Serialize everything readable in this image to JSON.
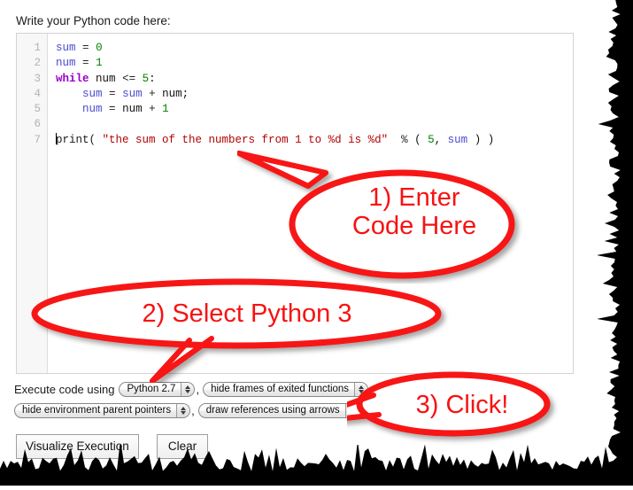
{
  "page": {
    "prompt_label": "Write your Python code here:"
  },
  "editor": {
    "line_numbers": [
      "1",
      "2",
      "3",
      "4",
      "5",
      "6",
      "7"
    ],
    "lines": [
      {
        "n": "1",
        "tokens": [
          {
            "t": "var",
            "s": "sum"
          },
          {
            "t": "plain",
            "s": " "
          },
          {
            "t": "op",
            "s": "="
          },
          {
            "t": "plain",
            "s": " "
          },
          {
            "t": "num",
            "s": "0"
          }
        ]
      },
      {
        "n": "2",
        "tokens": [
          {
            "t": "var",
            "s": "num"
          },
          {
            "t": "plain",
            "s": " "
          },
          {
            "t": "op",
            "s": "="
          },
          {
            "t": "plain",
            "s": " "
          },
          {
            "t": "num",
            "s": "1"
          }
        ]
      },
      {
        "n": "3",
        "tokens": [
          {
            "t": "kw",
            "s": "while"
          },
          {
            "t": "plain",
            "s": " "
          },
          {
            "t": "plain",
            "s": "num"
          },
          {
            "t": "plain",
            "s": " "
          },
          {
            "t": "op",
            "s": "<="
          },
          {
            "t": "plain",
            "s": " "
          },
          {
            "t": "num",
            "s": "5"
          },
          {
            "t": "plain",
            "s": ":"
          }
        ]
      },
      {
        "n": "4",
        "tokens": [
          {
            "t": "plain",
            "s": "    "
          },
          {
            "t": "var",
            "s": "sum"
          },
          {
            "t": "plain",
            "s": " "
          },
          {
            "t": "op",
            "s": "="
          },
          {
            "t": "plain",
            "s": " "
          },
          {
            "t": "var",
            "s": "sum"
          },
          {
            "t": "plain",
            "s": " "
          },
          {
            "t": "op",
            "s": "+"
          },
          {
            "t": "plain",
            "s": " "
          },
          {
            "t": "plain",
            "s": "num;"
          }
        ]
      },
      {
        "n": "5",
        "tokens": [
          {
            "t": "plain",
            "s": "    "
          },
          {
            "t": "var",
            "s": "num"
          },
          {
            "t": "plain",
            "s": " "
          },
          {
            "t": "op",
            "s": "="
          },
          {
            "t": "plain",
            "s": " "
          },
          {
            "t": "plain",
            "s": "num"
          },
          {
            "t": "plain",
            "s": " "
          },
          {
            "t": "op",
            "s": "+"
          },
          {
            "t": "plain",
            "s": " "
          },
          {
            "t": "num",
            "s": "1"
          }
        ]
      },
      {
        "n": "6",
        "tokens": []
      },
      {
        "n": "7",
        "tokens": [
          {
            "t": "caret",
            "s": ""
          },
          {
            "t": "fn",
            "s": "print("
          },
          {
            "t": "plain",
            "s": " "
          },
          {
            "t": "str",
            "s": "\"the sum of the numbers from 1 to %d is %d\""
          },
          {
            "t": "plain",
            "s": "  "
          },
          {
            "t": "op",
            "s": "%"
          },
          {
            "t": "plain",
            "s": " ( "
          },
          {
            "t": "num",
            "s": "5"
          },
          {
            "t": "plain",
            "s": ", "
          },
          {
            "t": "var",
            "s": "sum"
          },
          {
            "t": "plain",
            "s": " ) )"
          }
        ]
      }
    ],
    "plain_text": "sum = 0\nnum = 1\nwhile num <= 5:\n    sum = sum + num;\n    num = num + 1\n\nprint( \"the sum of the numbers from 1 to %d is %d\"  % ( 5, sum ) )"
  },
  "controls": {
    "execute_label": "Execute code using",
    "python_version": "Python 2.7",
    "option_frames": "hide frames of exited functions",
    "option_env_pointers": "hide environment parent pointers",
    "option_references": "draw references using arrows",
    "comma": ","
  },
  "buttons": {
    "visualize": "Visualize Execution",
    "clear": "Clear"
  },
  "callouts": [
    {
      "id": "1",
      "text": "1) Enter\nCode Here",
      "color": "#f71212"
    },
    {
      "id": "2",
      "text": "2) Select Python 3",
      "color": "#f71212"
    },
    {
      "id": "3",
      "text": "3) Click!",
      "color": "#f71212"
    }
  ],
  "colors": {
    "callout_red": "#f71212",
    "keyword_purple": "#9a00c9",
    "variable_blue": "#4b4bd0",
    "string_red": "#b40000",
    "number_green": "#008000",
    "gutter_gray": "#b3b3b3",
    "editor_border": "#d3d3d3",
    "torn_edge": "#000000"
  }
}
